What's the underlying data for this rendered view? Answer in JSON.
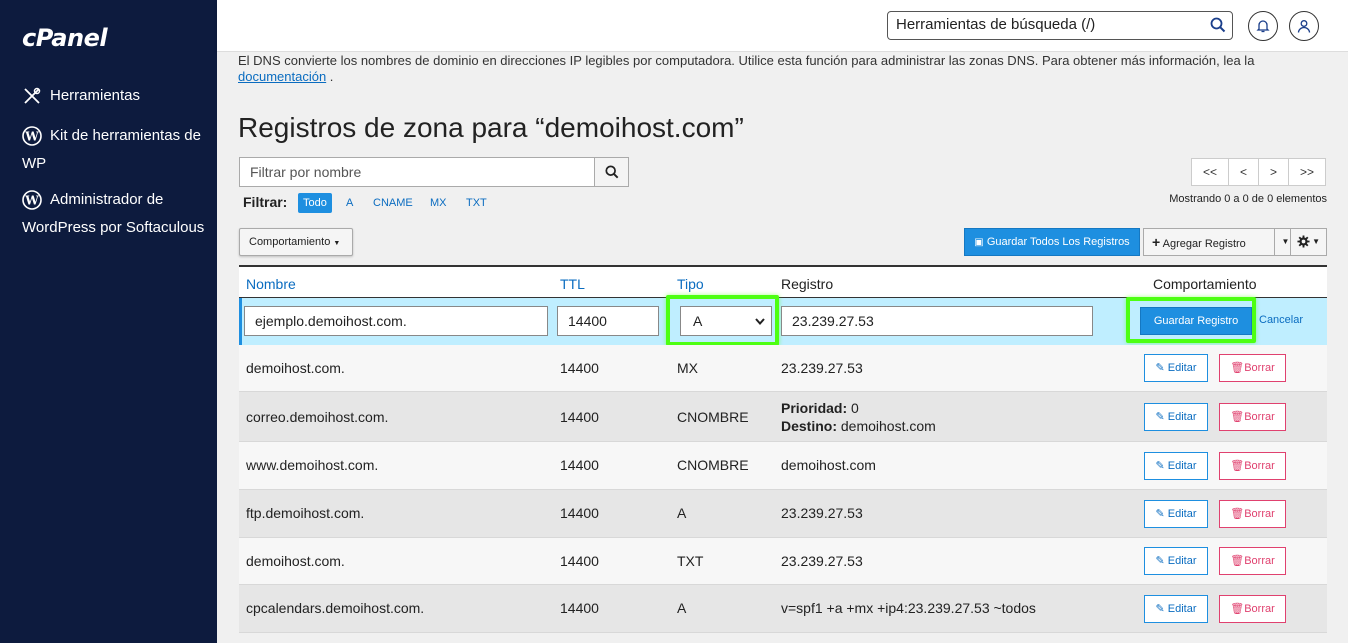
{
  "sidebar": {
    "logo": "cPanel",
    "items": [
      {
        "label": "Herramientas",
        "icon": "tools-icon"
      },
      {
        "label": "Kit de herramientas de WP",
        "icon": "wordpress-icon"
      },
      {
        "label": "Administrador de WordPress por Softaculous",
        "icon": "wordpress-icon"
      }
    ]
  },
  "topbar": {
    "search_placeholder": "Herramientas de búsqueda (/)"
  },
  "intro": {
    "text": "El DNS convierte los nombres de dominio en direcciones IP legibles por computadora. Utilice esta función para administrar las zonas DNS. Para obtener más información, lea la",
    "link": "documentación",
    "suffix": "."
  },
  "title": "Registros de zona para “demoihost.com”",
  "filter": {
    "placeholder": "Filtrar por nombre",
    "label": "Filtrar:",
    "tags": [
      "Todo",
      "A",
      "CNAME",
      "MX",
      "TXT"
    ]
  },
  "pager": {
    "buttons": [
      "<<",
      "<",
      ">",
      ">>"
    ],
    "showing": "Mostrando 0 a 0 de 0 elementos"
  },
  "toolbar": {
    "behavior": "Comportamiento",
    "save_all": "Guardar Todos Los Registros",
    "add": "Agregar Registro"
  },
  "table": {
    "headers": {
      "name": "Nombre",
      "ttl": "TTL",
      "type": "Tipo",
      "record": "Registro",
      "actions": "Comportamiento"
    },
    "edit_row": {
      "name": "ejemplo.demoihost.com.",
      "ttl": "14400",
      "type": "A",
      "record": "23.239.27.53",
      "save": "Guardar Registro",
      "cancel": "Cancelar"
    },
    "actions": {
      "edit": "Editar",
      "delete": "Borrar"
    },
    "rows": [
      {
        "name": "demoihost.com.",
        "ttl": "14400",
        "type": "MX",
        "record": "23.239.27.53"
      },
      {
        "name": "correo.demoihost.com.",
        "ttl": "14400",
        "type": "CNOMBRE",
        "priority_label": "Prioridad:",
        "priority": "0",
        "dest_label": "Destino:",
        "dest": "demoihost.com"
      },
      {
        "name": "www.demoihost.com.",
        "ttl": "14400",
        "type": "CNOMBRE",
        "record": "demoihost.com"
      },
      {
        "name": "ftp.demoihost.com.",
        "ttl": "14400",
        "type": "A",
        "record": "23.239.27.53"
      },
      {
        "name": "demoihost.com.",
        "ttl": "14400",
        "type": "TXT",
        "record": "23.239.27.53"
      },
      {
        "name": "cpcalendars.demoihost.com.",
        "ttl": "14400",
        "type": "A",
        "record": "v=spf1 +a +mx +ip4:23.239.27.53 ~todos"
      }
    ]
  },
  "colors": {
    "sidebar": "#0d1b3e",
    "accent": "#1e8fe0",
    "highlight": "#4dff12",
    "delete": "#e0416f"
  }
}
